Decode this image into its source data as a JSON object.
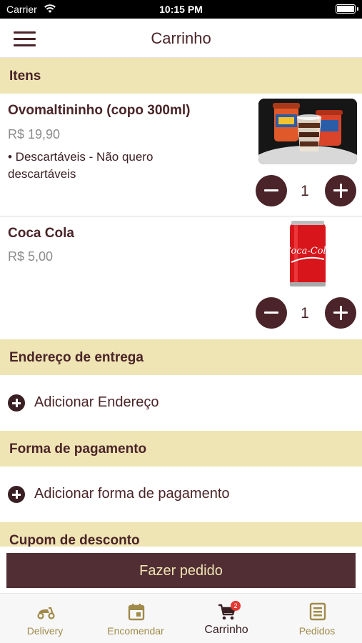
{
  "status_bar": {
    "carrier": "Carrier",
    "time": "10:15 PM"
  },
  "header": {
    "title": "Carrinho",
    "menu_icon": "hamburger-menu-icon"
  },
  "sections": {
    "items_title": "Itens",
    "address_title": "Endereço de entrega",
    "payment_title": "Forma de pagamento",
    "coupon_title": "Cupom de desconto"
  },
  "items": [
    {
      "name": "Ovomaltininho (copo 300ml)",
      "price": "R$ 19,90",
      "note": "• Descartáveis - Não quero descartáveis",
      "quantity": "1",
      "image_icon": "ovomaltine-cup-photo"
    },
    {
      "name": "Coca Cola",
      "price": "R$ 5,00",
      "quantity": "1",
      "image_icon": "coca-cola-can-photo",
      "image_brand_text": "Coca-Cola"
    }
  ],
  "address": {
    "add_label": "Adicionar Endereço"
  },
  "payment": {
    "add_label": "Adicionar forma de pagamento"
  },
  "order_button": {
    "label": "Fazer pedido"
  },
  "tabbar": {
    "tabs": [
      {
        "label": "Delivery",
        "icon": "scooter-icon"
      },
      {
        "label": "Encomendar",
        "icon": "calendar-icon"
      },
      {
        "label": "Carrinho",
        "icon": "cart-icon",
        "badge": "2",
        "active": true
      },
      {
        "label": "Pedidos",
        "icon": "list-document-icon"
      }
    ]
  },
  "colors": {
    "primary": "#4a2428",
    "button": "#512e33",
    "section_bg": "#efe4b4",
    "tab_inactive": "#a08a4a",
    "badge": "#e53935"
  }
}
